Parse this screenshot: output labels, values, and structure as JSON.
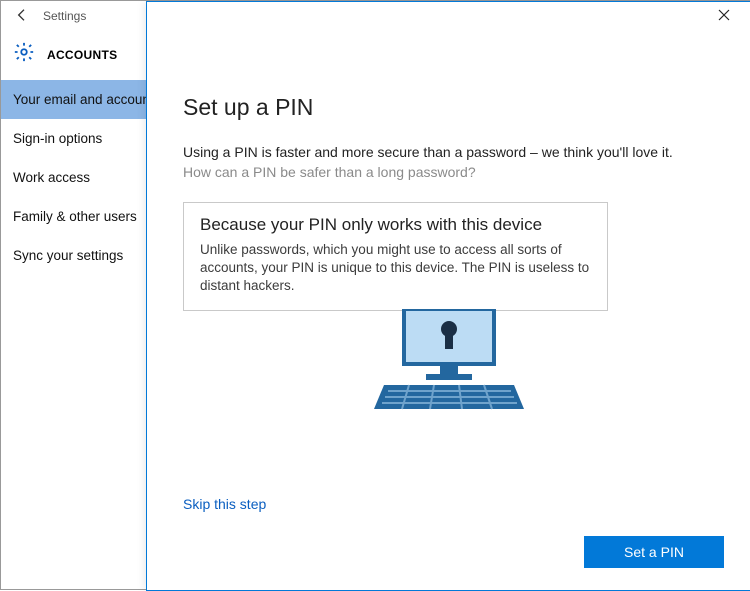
{
  "settings": {
    "window_label": "Settings",
    "section_title": "ACCOUNTS",
    "nav": [
      {
        "label": "Your email and accounts",
        "selected": true
      },
      {
        "label": "Sign-in options",
        "selected": false
      },
      {
        "label": "Work access",
        "selected": false
      },
      {
        "label": "Family & other users",
        "selected": false
      },
      {
        "label": "Sync your settings",
        "selected": false
      }
    ]
  },
  "dialog": {
    "title": "Set up a PIN",
    "description": "Using a PIN is faster and more secure than a password – we think you'll love it.",
    "sub_question": "How can a PIN be safer than a long password?",
    "info": {
      "title": "Because your PIN only works with this device",
      "text": "Unlike passwords, which you might use to access all sorts of accounts, your PIN is unique to this device. The PIN is useless to distant hackers."
    },
    "skip_label": "Skip this step",
    "primary_button": "Set a PIN"
  }
}
